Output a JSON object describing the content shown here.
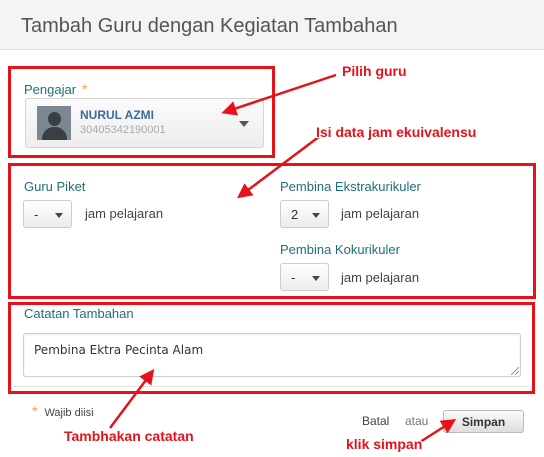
{
  "header": {
    "title": "Tambah Guru dengan Kegiatan Tambahan"
  },
  "teacher": {
    "label": "Pengajar",
    "required_mark": "*",
    "name": "NURUL AZMI",
    "id": "30405342190001"
  },
  "hours": {
    "guru_piket": {
      "label": "Guru Piket",
      "value": "-",
      "unit": "jam pelajaran"
    },
    "pembina_ekstrakurikuler": {
      "label": "Pembina Ekstrakurikuler",
      "value": "2",
      "unit": "jam pelajaran"
    },
    "pembina_kokurikuler": {
      "label": "Pembina Kokurikuler",
      "value": "-",
      "unit": "jam pelajaran"
    }
  },
  "notes": {
    "label": "Catatan Tambahan",
    "value": "Pembina Ektra Pecinta Alam"
  },
  "footer": {
    "required_star": "*",
    "required_note": "Wajib diisi",
    "cancel_label": "Batal",
    "or_label": "atau",
    "save_label": "Simpan"
  },
  "annotations": {
    "pick_teacher": "Pilih guru",
    "fill_hours": "Isi data jam ekuivalensu",
    "add_notes": "Tambhakan catatan",
    "click_save": "klik simpan"
  },
  "colors": {
    "annotation_red": "#e5121a",
    "label_teal": "#1e6f7a",
    "name_blue": "#3b6c9a",
    "required_orange": "#f2a33a"
  }
}
